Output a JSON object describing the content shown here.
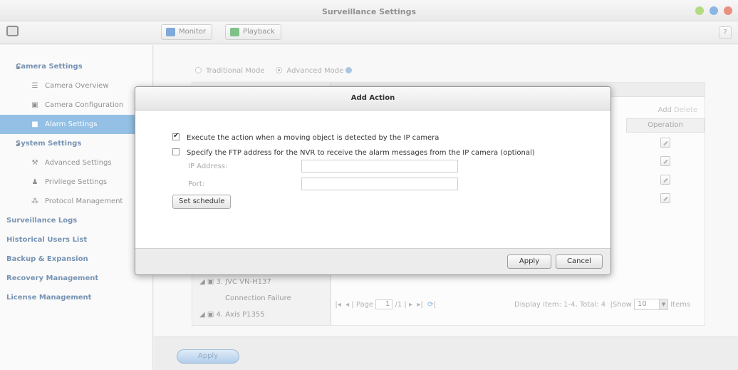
{
  "window": {
    "title": "Surveillance Settings",
    "controls": {
      "minimize_color": "#8cc63f",
      "maximize_color": "#4a90d9",
      "close_color": "#e0533b"
    }
  },
  "toolbar": {
    "monitor_label": "Monitor",
    "playback_label": "Playback",
    "help_label": "?"
  },
  "sidebar": {
    "items": [
      {
        "label": "Camera Settings",
        "kind": "group"
      },
      {
        "label": "Camera Overview",
        "kind": "sub",
        "icon": "list-icon"
      },
      {
        "label": "Camera Configuration",
        "kind": "sub",
        "icon": "camera-icon"
      },
      {
        "label": "Alarm Settings",
        "kind": "sub",
        "icon": "alarm-icon",
        "selected": true
      },
      {
        "label": "System Settings",
        "kind": "group"
      },
      {
        "label": "Advanced Settings",
        "kind": "sub",
        "icon": "wrench-icon"
      },
      {
        "label": "Privilege Settings",
        "kind": "sub",
        "icon": "user-icon"
      },
      {
        "label": "Protocol Management",
        "kind": "sub",
        "icon": "network-icon"
      },
      {
        "label": "Surveillance Logs",
        "kind": "top"
      },
      {
        "label": "Historical Users List",
        "kind": "top"
      },
      {
        "label": "Backup & Expansion",
        "kind": "top"
      },
      {
        "label": "Recovery Management",
        "kind": "top"
      },
      {
        "label": "License Management",
        "kind": "top"
      }
    ]
  },
  "main": {
    "mode": {
      "traditional_label": "Traditional Mode",
      "advanced_label": "Advanced Mode",
      "selected": "advanced"
    },
    "camera_list": [
      {
        "label": "3. JVC VN-H137"
      },
      {
        "label": "Connection Failure"
      },
      {
        "label": "4. Axis P1355"
      }
    ],
    "table": {
      "add_label": "Add",
      "delete_label": "Delete",
      "operation_header": "Operation",
      "row_count": 4
    },
    "pager": {
      "page_label": "Page",
      "page_value": "1",
      "total_pages": "/1",
      "display_text": "Display item: 1-4, Total: 4",
      "show_label": "Show",
      "show_value": "10",
      "items_label": "Items"
    },
    "apply_label": "Apply"
  },
  "dialog": {
    "title": "Add Action",
    "option1": {
      "label": "Execute the action when a moving object is detected by the IP camera",
      "checked": true
    },
    "option2": {
      "label": "Specify the FTP address for the NVR to receive the alarm messages from the IP camera (optional)",
      "checked": false
    },
    "ip_label": "IP Address:",
    "ip_value": "",
    "port_label": "Port:",
    "port_value": "",
    "schedule_label": "Set schedule",
    "apply_label": "Apply",
    "cancel_label": "Cancel"
  }
}
